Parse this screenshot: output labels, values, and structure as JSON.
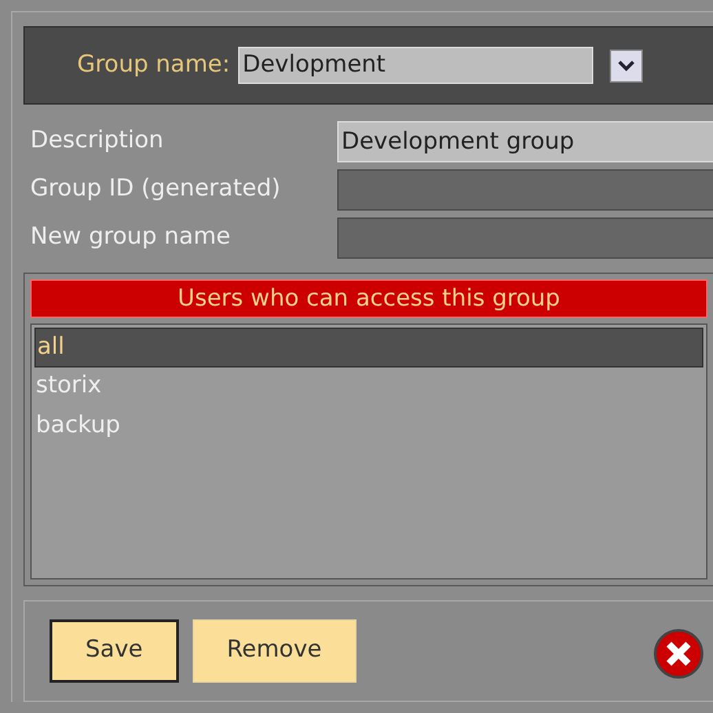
{
  "group_name": {
    "label": "Group name:",
    "value": "Devlopment"
  },
  "fields": [
    {
      "label": "Description",
      "value": "Development group",
      "editable": true
    },
    {
      "label": "Group ID (generated)",
      "editable": false
    },
    {
      "label": "New group name",
      "editable": false
    }
  ],
  "users": {
    "title": "Users who can access this group",
    "items": [
      {
        "name": "all",
        "selected": true
      },
      {
        "name": "storix",
        "selected": false
      },
      {
        "name": "backup",
        "selected": false
      }
    ]
  },
  "buttons": [
    {
      "label": "Save",
      "focused": true
    },
    {
      "label": "Remove",
      "focused": false
    }
  ]
}
